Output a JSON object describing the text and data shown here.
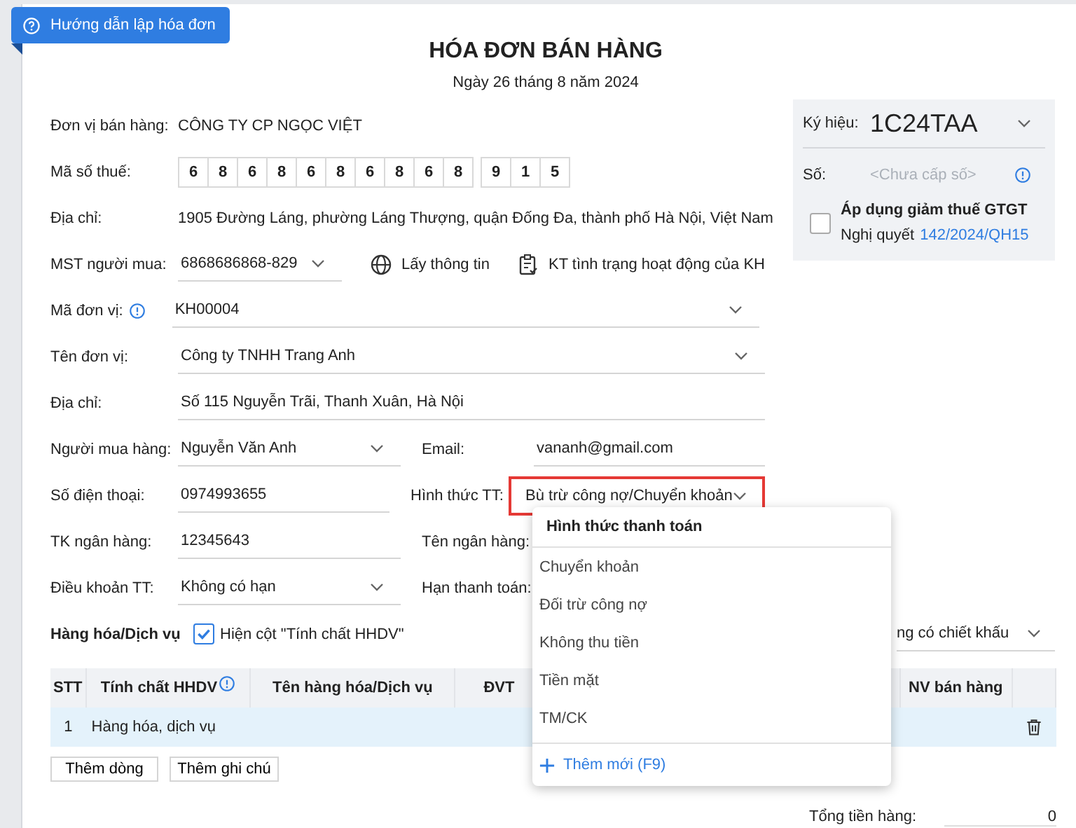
{
  "help_button": {
    "label": "Hướng dẫn lập hóa đơn"
  },
  "title": "HÓA ĐƠN BÁN HÀNG",
  "date": "Ngày 26 tháng 8 năm 2024",
  "seller": [
    {
      "kind": "text",
      "label": "Đơn vị bán hàng:",
      "value": "CÔNG TY CP NGỌC VIỆT"
    },
    {
      "kind": "digits",
      "label": "Mã số thuế:",
      "groups": [
        [
          "6",
          "8",
          "6",
          "8",
          "6",
          "8",
          "6",
          "8",
          "6",
          "8"
        ],
        [
          "9",
          "1",
          "5"
        ]
      ]
    },
    {
      "kind": "text",
      "label": "Địa chỉ:",
      "value": "1905 Đường Láng, phường Láng Thượng, quận Đống Đa, thành phố Hà Nội, Việt Nam"
    }
  ],
  "buyer_tax": {
    "label": "MST người mua:",
    "value": "6868686868-829",
    "actions": [
      {
        "kind": "globe",
        "label": "Lấy thông tin"
      },
      {
        "kind": "clipboard",
        "label": "KT tình trạng hoạt động của KH"
      }
    ]
  },
  "buyer": [
    {
      "cells": [
        {
          "label": "Mã đơn vị:",
          "info": true,
          "value": "KH00004",
          "dropdown": true,
          "highlighted": false
        }
      ]
    },
    {
      "cells": [
        {
          "label": "Tên đơn vị:",
          "info": false,
          "value": "Công ty TNHH Trang Anh",
          "dropdown": true,
          "highlighted": false
        }
      ]
    },
    {
      "cells": [
        {
          "label": "Địa chỉ:",
          "info": false,
          "value": "Số 115 Nguyễn Trãi, Thanh Xuân, Hà Nội",
          "dropdown": false,
          "highlighted": false
        }
      ]
    },
    {
      "cells": [
        {
          "label": "Người mua hàng:",
          "info": false,
          "value": "Nguyễn Văn Anh",
          "dropdown": true,
          "highlighted": false
        },
        {
          "label": "Email:",
          "info": false,
          "value": "vananh@gmail.com",
          "dropdown": false,
          "highlighted": false
        }
      ]
    },
    {
      "cells": [
        {
          "label": "Số điện thoại:",
          "info": false,
          "value": "0974993655",
          "dropdown": false,
          "highlighted": false
        },
        {
          "label": "Hình thức TT:",
          "info": false,
          "value": "Bù trừ công nợ/Chuyển khoản",
          "dropdown": true,
          "highlighted": true
        }
      ]
    },
    {
      "cells": [
        {
          "label": "TK ngân hàng:",
          "info": false,
          "value": "12345643",
          "dropdown": false,
          "highlighted": false
        },
        {
          "label": "Tên ngân hàng:"
        }
      ]
    },
    {
      "cells": [
        {
          "label": "Điều khoản TT:",
          "info": false,
          "value": "Không có hạn",
          "dropdown": true,
          "highlighted": false
        },
        {
          "label": "Hạn thanh toán:"
        }
      ]
    }
  ],
  "invoice_panel": {
    "symbol_label": "Ký hiệu:",
    "symbol": "1C24TAA",
    "number_label": "Số:",
    "number_placeholder": "<Chưa cấp số>",
    "vat_reduction": {
      "checked": false,
      "title": "Áp dụng giảm thuế GTGT",
      "note": "Nghị quyết",
      "link": "142/2024/QH15"
    }
  },
  "goods": {
    "title": "Hàng hóa/Dịch vụ",
    "show_column": {
      "checked": true,
      "label": "Hiện cột \"Tính chất HHDV\""
    },
    "discount_select": "ng có chiết khấu"
  },
  "table": {
    "columns": [
      {
        "label": "STT",
        "info": false
      },
      {
        "label": "Tính chất HHDV",
        "info": true
      },
      {
        "label": "Tên hàng hóa/Dịch vụ",
        "info": false
      },
      {
        "label": "ĐVT",
        "info": false
      },
      {
        "label": "NV bán hàng",
        "info": false
      }
    ],
    "rows": [
      {
        "stt": "1",
        "kind": "Hàng hóa, dịch vụ"
      }
    ]
  },
  "table_buttons": [
    "Thêm dòng",
    "Thêm ghi chú"
  ],
  "total": {
    "label": "Tổng tiền hàng:",
    "value": "0"
  },
  "dropdown": {
    "header": "Hình thức thanh toán",
    "options": [
      {
        "label": "Chuyển khoản",
        "selected": false
      },
      {
        "label": "Đối trừ công nợ",
        "selected": false
      },
      {
        "label": "Không thu tiền",
        "selected": false
      },
      {
        "label": "Tiền mặt",
        "selected": false
      },
      {
        "label": "TM/CK",
        "selected": false
      }
    ],
    "add_new": "Thêm mới (F9)"
  }
}
